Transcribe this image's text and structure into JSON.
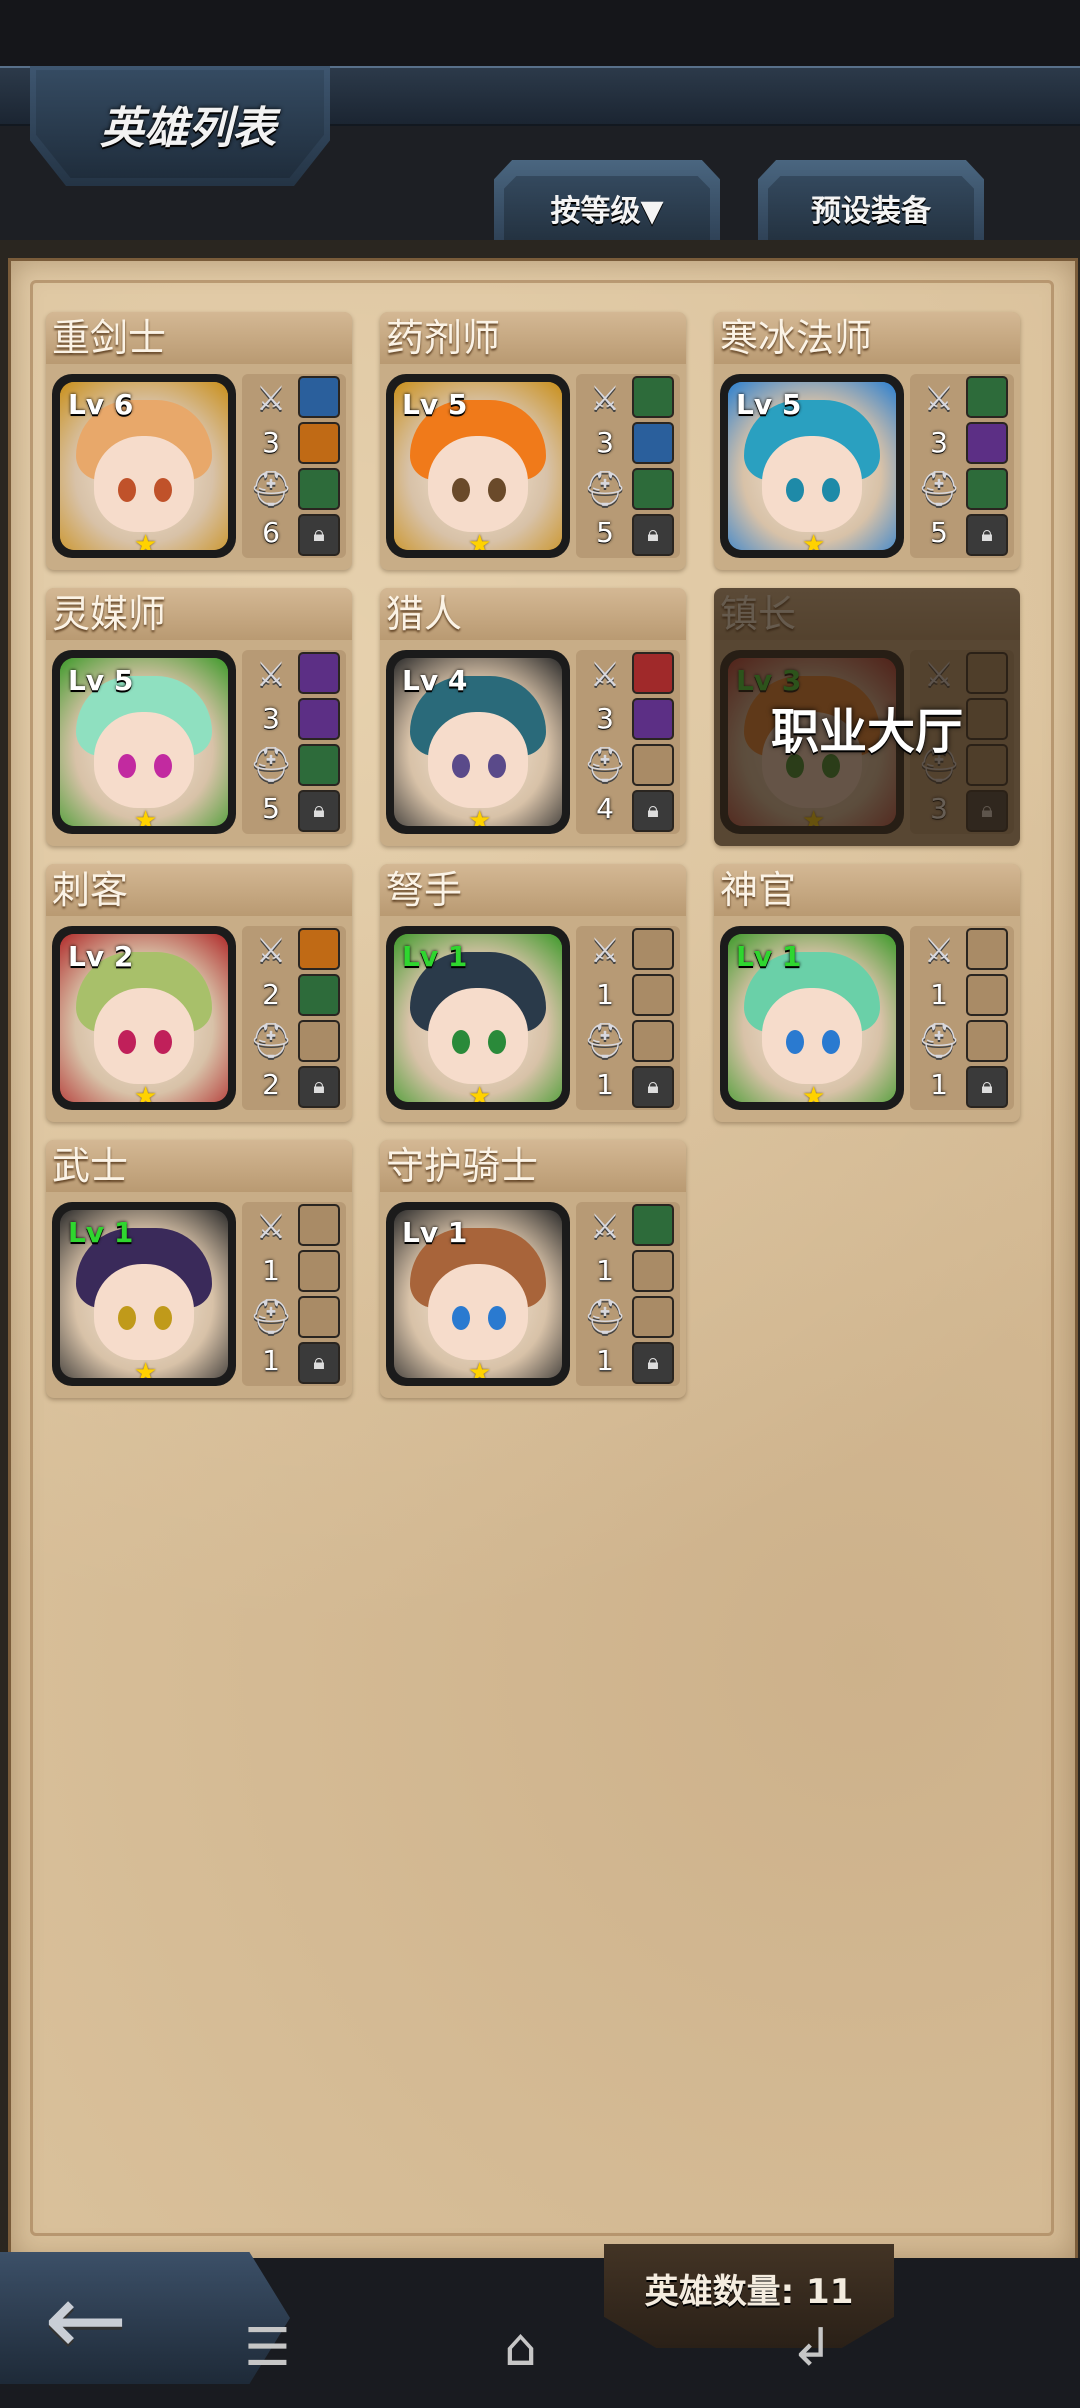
{
  "header": {
    "title": "英雄列表"
  },
  "tabs": {
    "sort_label": "按等级▼",
    "preset_label": "预设装备"
  },
  "heroes": [
    {
      "name": "重剑士",
      "level": "Lv 6",
      "weapon": "3",
      "armor": "6",
      "frame_color": "#c98f19",
      "hair": "#e8a86a",
      "eyes": "#c0522a"
    },
    {
      "name": "药剂师",
      "level": "Lv 5",
      "weapon": "3",
      "armor": "5",
      "frame_color": "#c98f19",
      "hair": "#f07a1a",
      "eyes": "#6a4a2a"
    },
    {
      "name": "寒冰法师",
      "level": "Lv 5",
      "weapon": "3",
      "armor": "5",
      "frame_color": "#2a7fd0",
      "hair": "#2aa0c0",
      "eyes": "#1e8aa8"
    },
    {
      "name": "灵媒师",
      "level": "Lv 5",
      "weapon": "3",
      "armor": "5",
      "frame_color": "#3d9a2a",
      "hair": "#8fe0c0",
      "eyes": "#c22aa0"
    },
    {
      "name": "猎人",
      "level": "Lv 4",
      "weapon": "3",
      "armor": "4",
      "frame_color": "#2b2b2b",
      "hair": "#2a6a7a",
      "eyes": "#5a4a8a"
    },
    {
      "name": "镇长",
      "level": "Lv 3",
      "weapon": "",
      "armor": "3",
      "frame_color": "#b02a2a",
      "hair": "#e07a2a",
      "eyes": "#2a8a2a",
      "overlay": "职业大厅"
    },
    {
      "name": "刺客",
      "level": "Lv 2",
      "weapon": "2",
      "armor": "2",
      "frame_color": "#b02a2a",
      "hair": "#a8c06a",
      "eyes": "#c0205a"
    },
    {
      "name": "弩手",
      "level": "Lv 1",
      "weapon": "1",
      "armor": "1",
      "frame_color": "#3d9a2a",
      "hair": "#2a3a4a",
      "eyes": "#2a8a3a"
    },
    {
      "name": "神官",
      "level": "Lv 1",
      "weapon": "1",
      "armor": "1",
      "frame_color": "#3d9a2a",
      "hair": "#6ad0a8",
      "eyes": "#2a7ad0"
    },
    {
      "name": "武士",
      "level": "Lv 1",
      "weapon": "1",
      "armor": "1",
      "frame_color": "#2b2b2b",
      "hair": "#3a2a5a",
      "eyes": "#c09a1a"
    },
    {
      "name": "守护骑士",
      "level": "Lv 1",
      "weapon": "1",
      "armor": "1",
      "frame_color": "#2b2b2b",
      "hair": "#a8643a",
      "eyes": "#2a7ad0"
    }
  ],
  "footer": {
    "hero_count": "英雄数量: 11"
  },
  "icons": {
    "weapon": "sword-icon",
    "armor": "helmet-icon",
    "lock": "lock-icon",
    "star": "star-icon"
  }
}
